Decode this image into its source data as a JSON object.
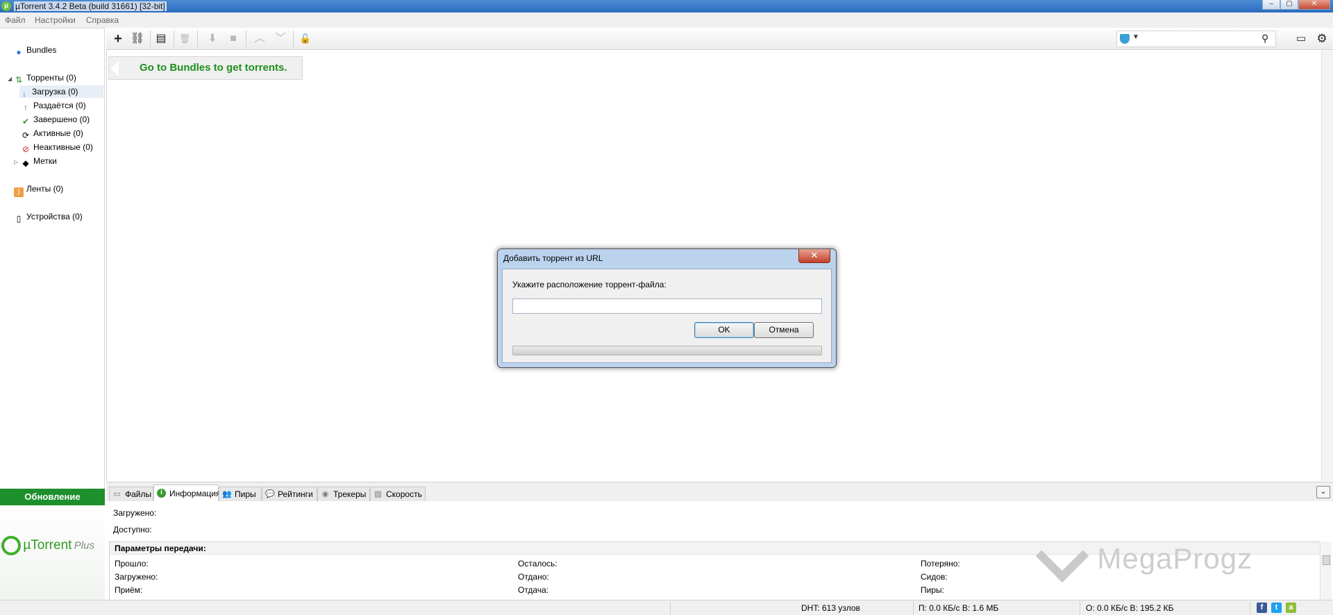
{
  "window": {
    "title": "µTorrent 3.4.2 Beta (build 31661) [32-bit]",
    "minimize": "–",
    "maximize": "▢",
    "close": "✕"
  },
  "menu": [
    "Файл",
    "Настройки",
    "Справка"
  ],
  "sidebar": {
    "bundles": "Bundles",
    "torrents": "Торренты (0)",
    "downloading": "Загрузка (0)",
    "seeding": "Раздаётся (0)",
    "completed": "Завершено (0)",
    "active": "Активные (0)",
    "inactive": "Неактивные (0)",
    "labels": "Метки",
    "feeds": "Ленты (0)",
    "devices": "Устройства (0)",
    "update_label": "Обновление",
    "plus_brand": "µTorrent",
    "plus_suffix": "Plus"
  },
  "toolbar": {
    "buttons": [
      {
        "name": "add-torrent-icon",
        "glyph": "+"
      },
      {
        "name": "add-url-icon",
        "glyph": "⛓"
      },
      {
        "name": "create-torrent-icon",
        "glyph": "▤"
      },
      {
        "name": "remove-icon",
        "glyph": "🗑"
      },
      {
        "name": "start-icon",
        "glyph": "⬇"
      },
      {
        "name": "stop-icon",
        "glyph": "■"
      },
      {
        "name": "move-up-icon",
        "glyph": "︿"
      },
      {
        "name": "move-down-icon",
        "glyph": "﹀"
      },
      {
        "name": "unlock-icon",
        "glyph": "🔓"
      }
    ],
    "search_placeholder": "",
    "remote_icon": "monitor-icon",
    "settings_icon": "gear-icon"
  },
  "main": {
    "bundles_banner": "Go to Bundles to get torrents."
  },
  "dialog": {
    "title": "Добавить торрент из URL",
    "close": "✕",
    "prompt": "Укажите расположение торрент-файла:",
    "url_value": "",
    "ok": "OK",
    "cancel": "Отмена",
    "progress": 0
  },
  "tabs": [
    {
      "name": "tab-files",
      "label": "Файлы",
      "icon": "▭"
    },
    {
      "name": "tab-info",
      "label": "Информация",
      "icon": "i"
    },
    {
      "name": "tab-peers",
      "label": "Пиры",
      "icon": "👥"
    },
    {
      "name": "tab-ratings",
      "label": "Рейтинги",
      "icon": "💬"
    },
    {
      "name": "tab-trackers",
      "label": "Трекеры",
      "icon": "◉"
    },
    {
      "name": "tab-speed",
      "label": "Скорость",
      "icon": "▨"
    }
  ],
  "info": {
    "downloaded": "Загружено:",
    "available": "Доступно:",
    "params_header": "Параметры передачи:",
    "elapsed": "Прошло:",
    "downloaded2": "Загружено:",
    "received": "Приём:",
    "remaining": "Осталось:",
    "uploaded": "Отдано:",
    "upload": "Отдача:",
    "wasted": "Потеряно:",
    "seeds": "Сидов:",
    "peers": "Пиры:"
  },
  "watermark": "MegaProgz",
  "status": {
    "dht": "DHT: 613 узлов",
    "download": "П: 0.0 КБ/с В: 1.6 МБ",
    "upload": "О: 0.0 КБ/с В: 195.2 КБ"
  },
  "colors": {
    "accent_green": "#1e8f2d",
    "banner_text": "#1f8f1f",
    "titlebar": "#2b6cc0"
  }
}
